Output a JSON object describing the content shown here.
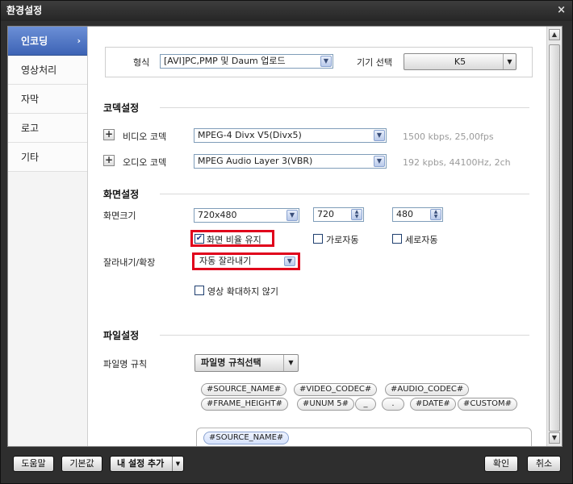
{
  "window": {
    "title": "환경설정",
    "close_glyph": "×"
  },
  "sidebar": {
    "items": [
      {
        "label": "인코딩",
        "active": true,
        "chevron": "›"
      },
      {
        "label": "영상처리"
      },
      {
        "label": "자막"
      },
      {
        "label": "로고"
      },
      {
        "label": "기타"
      }
    ]
  },
  "format": {
    "label": "형식",
    "value": "[AVI]PC,PMP 및 Daum 업로드",
    "device_label": "기기 선택",
    "device_value": "K5"
  },
  "codec": {
    "title": "코덱설정",
    "video_label": "비디오 코덱",
    "video_value": "MPEG-4 Divx V5(Divx5)",
    "video_hint": "1500 kbps, 25,00fps",
    "audio_label": "오디오 코덱",
    "audio_value": "MPEG Audio Layer 3(VBR)",
    "audio_hint": "192 kpbs, 44100Hz, 2ch",
    "plus_glyph": "+"
  },
  "screen": {
    "title": "화면설정",
    "size_label": "화면크기",
    "size_value": "720x480",
    "width_value": "720",
    "height_value": "480",
    "keep_ratio_label": "화면 비율 유지",
    "keep_ratio_checked": true,
    "auto_width_label": "가로자동",
    "auto_height_label": "세로자동",
    "crop_label": "잘라내기/확장",
    "crop_value": "자동 잘라내기",
    "no_zoom_label": "영상 확대하지 않기"
  },
  "file": {
    "title": "파일설정",
    "rule_label": "파일명 규칙",
    "rule_button": "파일명 규칙선택",
    "tags_row1": [
      "#SOURCE_NAME#",
      "#VIDEO_CODEC#",
      "#AUDIO_CODEC#"
    ],
    "tags_row2": [
      "#FRAME_HEIGHT#",
      "#UNUM 5#",
      "_",
      ".",
      "#DATE#",
      "#CUSTOM#"
    ],
    "preview_tag": "#SOURCE_NAME#"
  },
  "footer": {
    "help": "도움말",
    "default": "기본값",
    "add_my_setting": "내 설정 추가",
    "ok": "확인",
    "cancel": "취소"
  },
  "icons": {
    "dropdown": "▼",
    "spin_up": "▲",
    "spin_down": "▼",
    "check": "✔",
    "scroll_up": "▲",
    "scroll_down": "▼"
  }
}
